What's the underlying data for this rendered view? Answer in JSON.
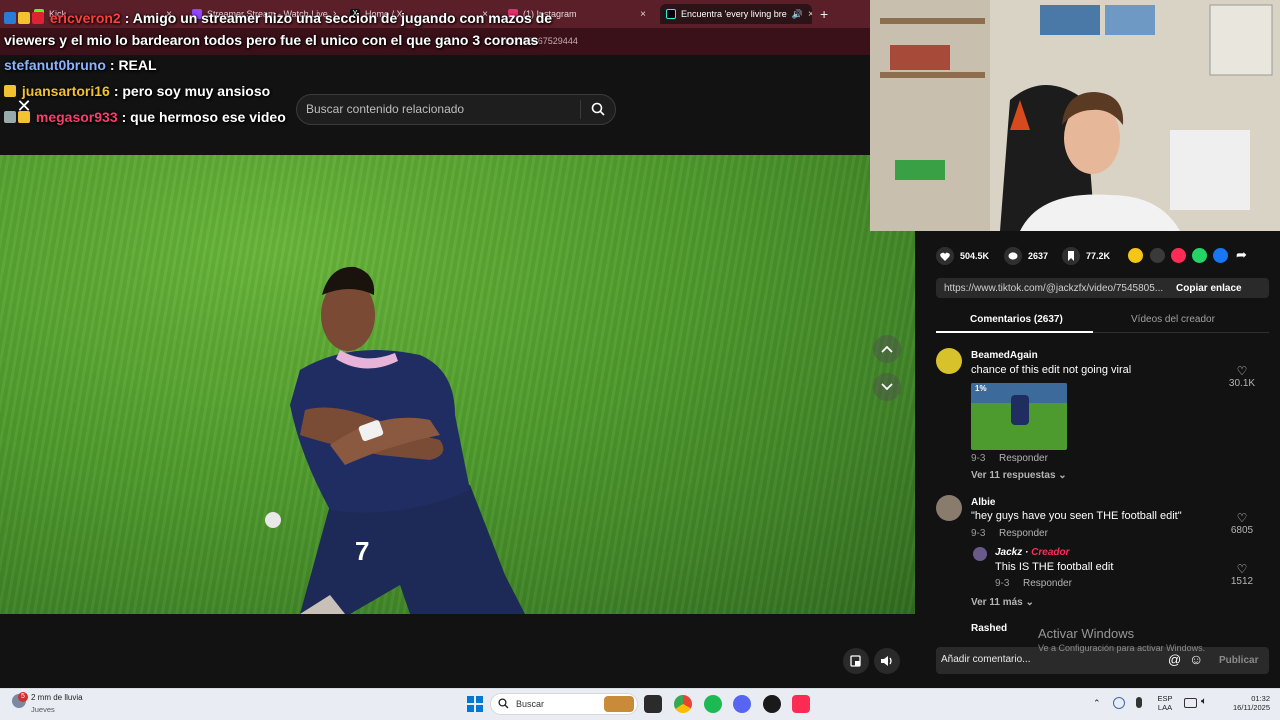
{
  "browser": {
    "tabs": [
      {
        "label": "Kick",
        "color": "#53fc18",
        "active": false
      },
      {
        "label": "Streamer Stream - Watch Live",
        "color": "#9146ff",
        "active": false
      },
      {
        "label": "Home / X",
        "color": "#111111",
        "active": false
      },
      {
        "label": "(1) Instagram",
        "color": "#e1306c",
        "active": false
      },
      {
        "label": "Encuentra 'every living bre",
        "color": "#010101",
        "active": true
      }
    ],
    "url_fragment": "t=1763267529444"
  },
  "chat": [
    {
      "user": "ericveron2",
      "user_color": "#ff3e3e",
      "message": ": Amigo un streamer hizo una seccion de jugando con mazos de"
    },
    {
      "user": "",
      "user_color": "#ffffff",
      "message": "viewers y el mio lo bardearon todos pero fue el unico con el que gano 3 coronas"
    },
    {
      "user": "stefanut0bruno",
      "user_color": "#8ab4ff",
      "message": ": REAL"
    },
    {
      "user": "juansartori16",
      "user_color": "#f2c230",
      "message": ": pero soy muy ansioso"
    },
    {
      "user": "megasor933",
      "user_color": "#ff3b6b",
      "message": ": que hermoso ese video"
    }
  ],
  "search": {
    "placeholder": "Buscar contenido relacionado"
  },
  "actions": {
    "likes": "504.5K",
    "comments": "2637",
    "saves": "77.2K"
  },
  "link": {
    "url": "https://www.tiktok.com/@jackzfx/video/7545805...",
    "copy_label": "Copiar enlace"
  },
  "tabs": {
    "comments": "Comentarios (2637)",
    "creator_videos": "Vídeos del creador"
  },
  "comments": [
    {
      "name": "BeamedAgain",
      "text": "chance of this edit not going viral",
      "date": "9-3",
      "reply": "Responder",
      "likes": "30.1K",
      "more": "Ver 11 respuestas",
      "image_badge": "1%"
    },
    {
      "name": "Albie",
      "text": "\"hey guys have you seen THE football edit\"",
      "date": "9-3",
      "reply": "Responder",
      "likes": "6805"
    },
    {
      "name": "Jackz",
      "creator_tag": "Creador",
      "text": "This IS THE football edit",
      "date": "9-3",
      "reply": "Responder",
      "likes": "1512",
      "more": "Ver 11 más"
    },
    {
      "name": "Rashed"
    }
  ],
  "composer": {
    "placeholder": "Añadir comentario...",
    "publish": "Publicar"
  },
  "watermark": {
    "line1": "Activar Windows",
    "line2": "Ve a Configuración para activar Windows."
  },
  "taskbar": {
    "weather": "2 mm de lluvia",
    "weather_day": "Jueves",
    "weather_badge": "5",
    "search_placeholder": "Buscar",
    "lang1": "ESP",
    "lang2": "LAA",
    "time": "01:32",
    "date": "16/11/2025"
  }
}
